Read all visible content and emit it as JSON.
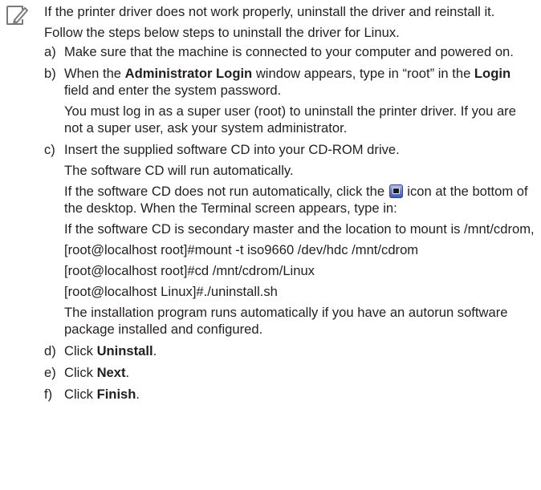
{
  "note": {
    "icon": "pencil-note-icon",
    "intro_lines": [
      "If the printer driver does not work properly, uninstall the driver and reinstall it.",
      "Follow the steps below steps to uninstall the driver for Linux."
    ]
  },
  "steps": [
    {
      "marker": "a)",
      "text": "Make sure that the machine is connected to your computer and powered on."
    },
    {
      "marker": "b)",
      "text_pre": "When the ",
      "bold1": "Administrator Login",
      "text_mid": " window appears, type in “root” in the ",
      "bold2": "Login",
      "text_post": " field and enter the system password.",
      "sub": [
        "You must log in as a super user (root) to uninstall the printer driver. If you are not a super user, ask your system administrator."
      ]
    },
    {
      "marker": "c)",
      "text": "Insert the supplied software CD into your CD-ROM drive.",
      "sub1": "The software CD will run automatically.",
      "icon_line_pre": "If the software CD does not run automatically, click the ",
      "icon_name": "terminal-icon",
      "icon_line_post": " icon at the bottom of the desktop. When the Terminal screen appears, type in:",
      "sub2": "If the software CD is secondary master and the location to mount is /mnt/cdrom,",
      "commands": [
        "[root@localhost root]#mount -t iso9660 /dev/hdc /mnt/cdrom",
        "[root@localhost root]#cd /mnt/cdrom/Linux",
        "[root@localhost Linux]#./uninstall.sh"
      ],
      "sub3": "The installation program runs automatically if you have an autorun software package installed and configured."
    },
    {
      "marker": "d)",
      "text_pre": "Click ",
      "bold": "Uninstall",
      "text_post": "."
    },
    {
      "marker": "e)",
      "text_pre": "Click ",
      "bold": "Next",
      "text_post": "."
    },
    {
      "marker": "f)",
      "text_pre": "Click ",
      "bold": "Finish",
      "text_post": "."
    }
  ]
}
